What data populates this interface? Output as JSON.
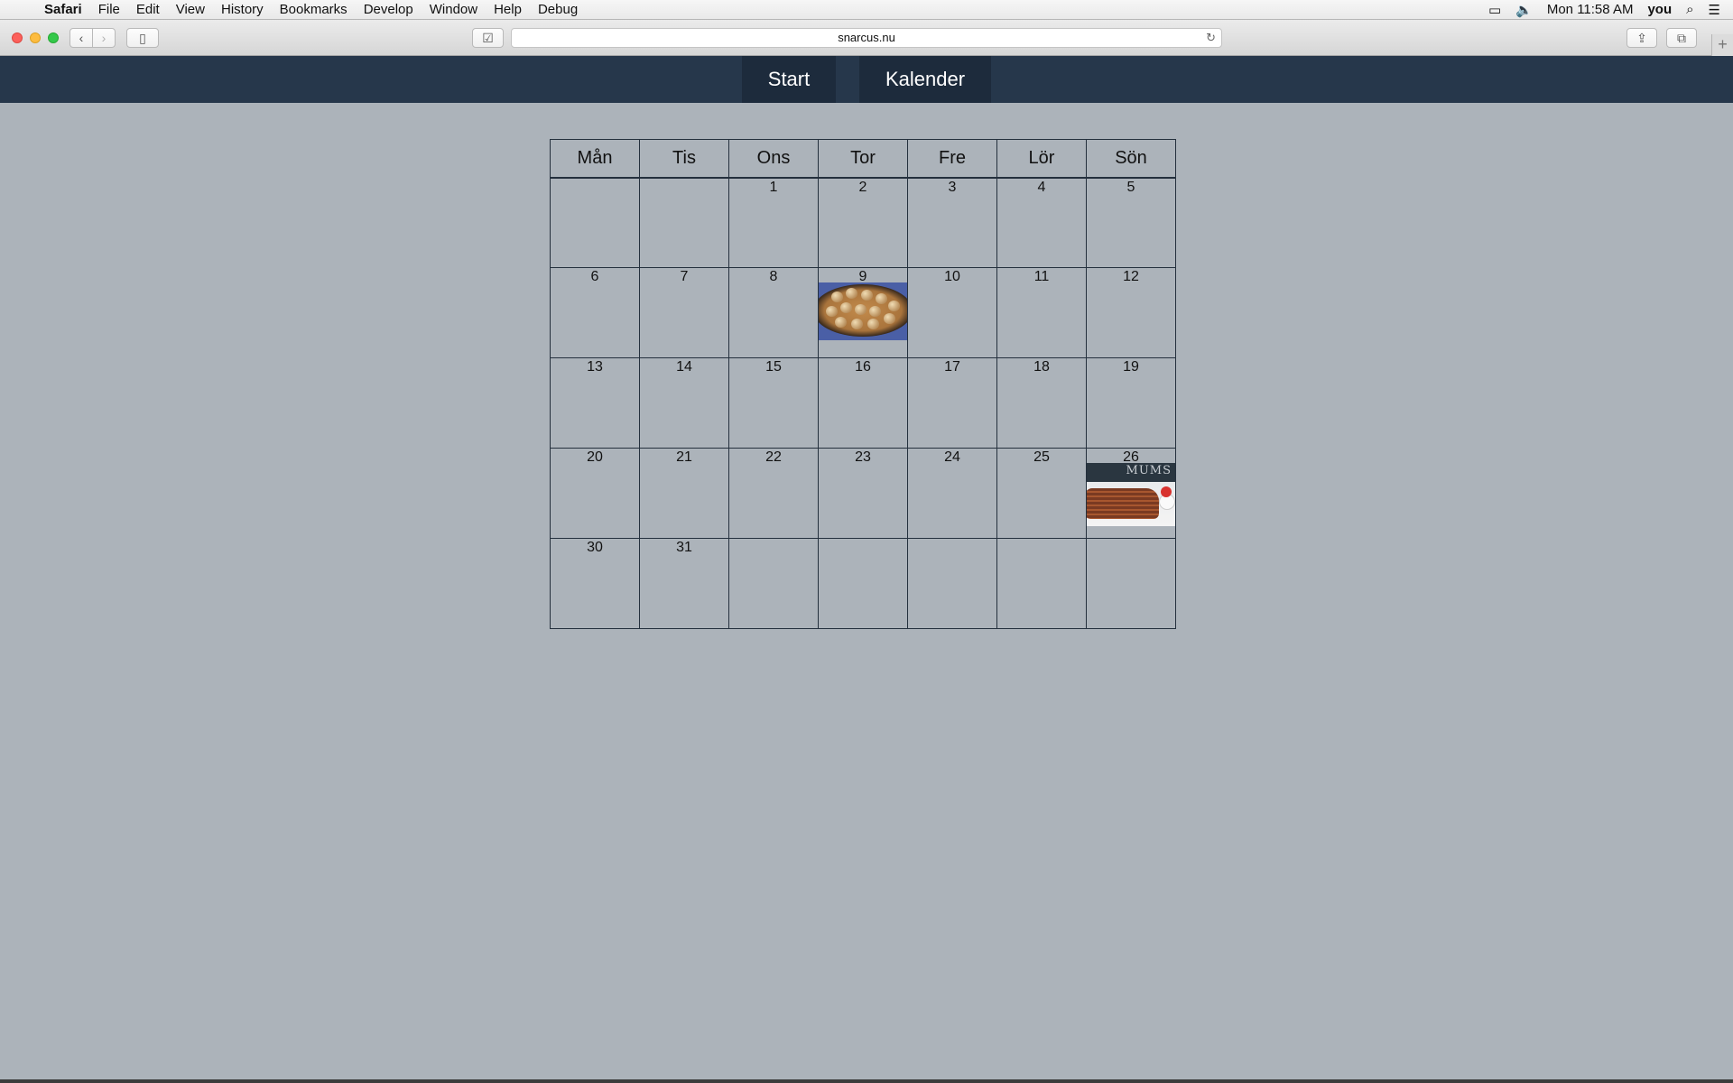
{
  "menubar": {
    "apple": "",
    "items": [
      "Safari",
      "File",
      "Edit",
      "View",
      "History",
      "Bookmarks",
      "Develop",
      "Window",
      "Help",
      "Debug"
    ],
    "clock": "Mon 11:58 AM",
    "user": "you"
  },
  "browser": {
    "url": "snarcus.nu"
  },
  "site_nav": {
    "start": "Start",
    "kalender": "Kalender"
  },
  "calendar": {
    "weekdays": [
      "Mån",
      "Tis",
      "Ons",
      "Tor",
      "Fre",
      "Lör",
      "Sön"
    ],
    "weeks": [
      [
        "",
        "",
        "1",
        "2",
        "3",
        "4",
        "5"
      ],
      [
        "6",
        "7",
        "8",
        "9",
        "10",
        "11",
        "12"
      ],
      [
        "13",
        "14",
        "15",
        "16",
        "17",
        "18",
        "19"
      ],
      [
        "20",
        "21",
        "22",
        "23",
        "24",
        "25",
        "26"
      ],
      [
        "30",
        "31",
        "",
        "",
        "",
        "",
        ""
      ]
    ],
    "events": {
      "9": "meatballs-photo",
      "26": "pancakes-photo"
    },
    "pancake_chalk_text": "MUMS"
  }
}
